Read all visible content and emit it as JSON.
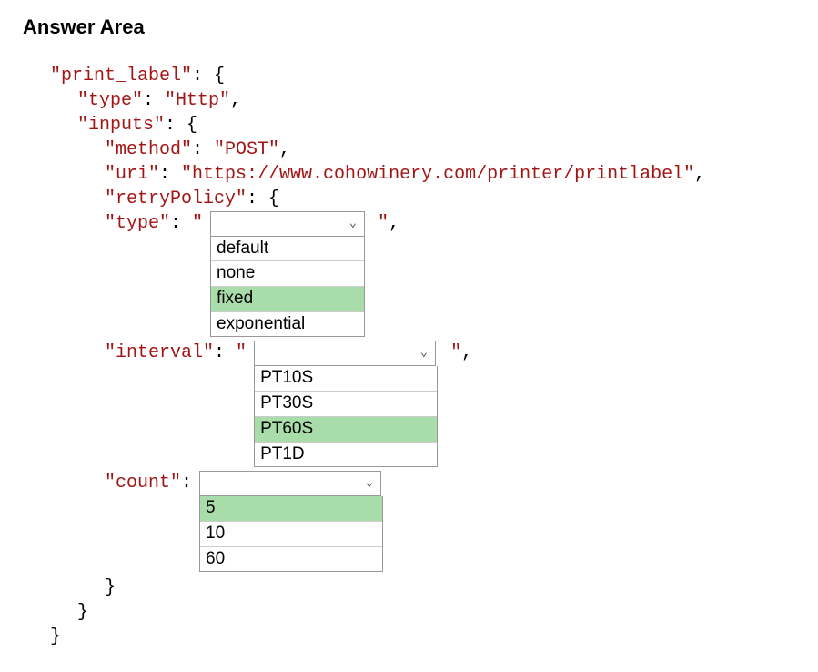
{
  "heading": "Answer Area",
  "json": {
    "key_print_label": "\"print_label\"",
    "key_type": "\"type\"",
    "val_http": "\"Http\"",
    "key_inputs": "\"inputs\"",
    "key_method": "\"method\"",
    "val_post": "\"POST\"",
    "key_uri": "\"uri\"",
    "val_uri": "\"https://www.cohowinery.com/printer/printlabel\"",
    "key_retry": "\"retryPolicy\"",
    "key_type2": "\"type\"",
    "key_interval": "\"interval\"",
    "key_count": "\"count\""
  },
  "dropdowns": {
    "type": {
      "options": [
        "default",
        "none",
        "fixed",
        "exponential"
      ],
      "selected": "fixed"
    },
    "interval": {
      "options": [
        "PT10S",
        "PT30S",
        "PT60S",
        "PT1D"
      ],
      "selected": "PT60S"
    },
    "count": {
      "options": [
        "5",
        "10",
        "60"
      ],
      "selected": "5"
    }
  }
}
